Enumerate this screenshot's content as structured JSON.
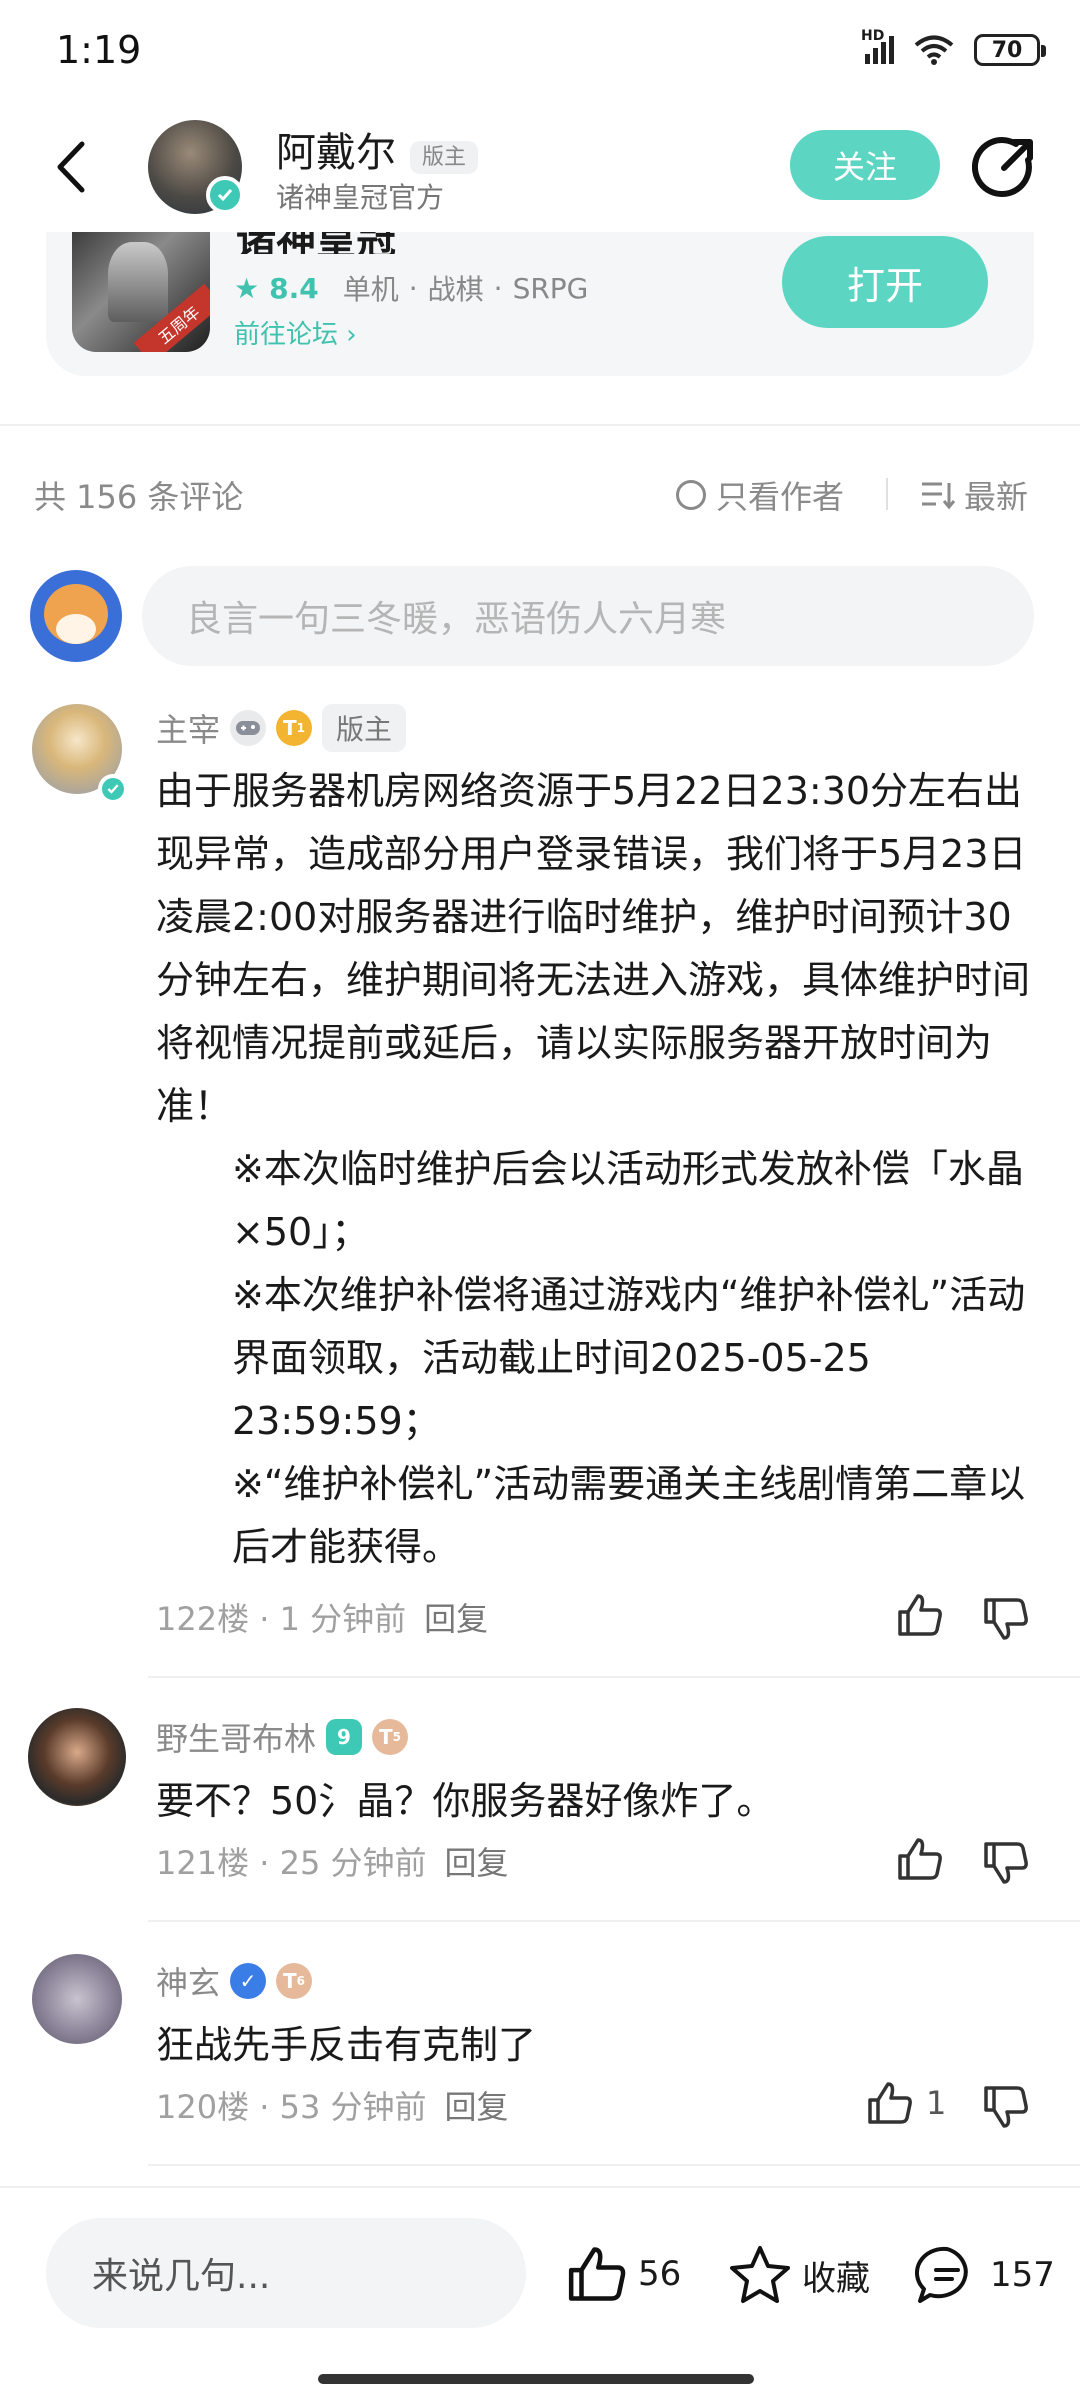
{
  "status": {
    "time": "1:19",
    "battery": "70",
    "network": "HD"
  },
  "header": {
    "author_name": "阿戴尔",
    "author_role": "版主",
    "author_sub": "诸神皇冠官方",
    "follow_label": "关注"
  },
  "game": {
    "title": "诸神皇冠",
    "badge": "五周年",
    "score": "8.4",
    "tags": [
      "单机",
      "战棋",
      "SRPG"
    ],
    "forum_link": "前往论坛",
    "open_label": "打开"
  },
  "comments_bar": {
    "count": "共 156 条评论",
    "only_author": "只看作者",
    "sort": "最新"
  },
  "input_placeholder": "良言一句三冬暖，恶语伤人六月寒",
  "comments": [
    {
      "user": "主宰",
      "level": "1",
      "tag": "版主",
      "lines": [
        "由于服务器机房网络资源于5月22日23:30分左右出现异常，造成部分用户登录错误，我们将于5月23日凌晨2:00对服务器进行临时维护，维护时间预计30分钟左右，维护期间将无法进入游戏，具体维护时间将视情况提前或延后，请以实际服务器开放时间为准！",
        "※本次临时维护后会以活动形式发放补偿「水晶×50」；",
        "※本次维护补偿将通过游戏内“维护补偿礼”活动界面领取，活动截止时间2025-05-25 23:59:59；",
        "※“维护补偿礼”活动需要通关主线剧情第二章以后才能获得。"
      ],
      "floor": "122楼",
      "time": "1 分钟前",
      "reply": "回复"
    },
    {
      "user": "野生哥布林",
      "level": "5",
      "badge": "9",
      "text": "要不？50氵晶？你服务器好像炸了。",
      "floor": "121楼",
      "time": "25 分钟前",
      "reply": "回复"
    },
    {
      "user": "神玄",
      "level": "6",
      "text": "狂战先手反击有克制了",
      "floor": "120楼",
      "time": "53 分钟前",
      "reply": "回复",
      "likes": "1"
    }
  ],
  "bottom": {
    "placeholder": "来说几句...",
    "likes": "56",
    "collect": "收藏",
    "comments": "157"
  },
  "colors": {
    "accent": "#5cd6c3",
    "accent_text": "#3fc2ae"
  }
}
